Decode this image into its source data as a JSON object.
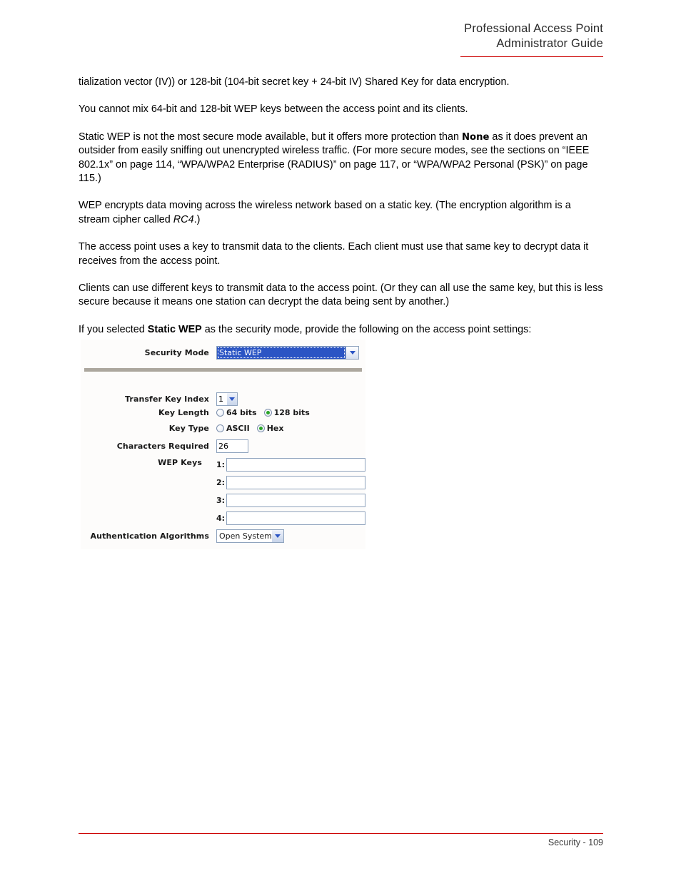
{
  "header": {
    "line1": "Professional Access Point",
    "line2": "Administrator Guide",
    "rule_color": "#cc0000"
  },
  "body": {
    "paragraph_1": "tialization vector (IV)) or 128-bit (104-bit secret key + 24-bit IV) Shared Key for data encryption.",
    "paragraph_2": "You cannot mix 64-bit and 128-bit WEP keys between the access point and its clients.",
    "paragraph_3_a": "Static WEP is not the most secure mode available, but it offers more protection than ",
    "paragraph_3_bold": "None",
    "paragraph_3_b": " as it does prevent an outsider from easily sniffing out unencrypted wireless traffic. (For more secure modes, see the sections on “IEEE 802.1x” on page 114, “WPA/WPA2 Enterprise (RADIUS)” on page 117, or “WPA/WPA2 Personal (PSK)” on page 115.)",
    "paragraph_4_a": "WEP encrypts data moving across the wireless network based on a static key. (The encryption algorithm is a stream cipher called ",
    "paragraph_4_italic": "RC4",
    "paragraph_4_b": ".)",
    "paragraph_5": "The access point uses a key to transmit data to the clients. Each client must use that same key to decrypt data it receives from the access point.",
    "paragraph_6": "Clients can use different keys to transmit data to the access point. (Or they can all use the same key, but this is less secure because it means one station can decrypt the data being sent by another.)",
    "paragraph_7_a": "If you selected ",
    "paragraph_7_bold": "Static WEP",
    "paragraph_7_b": " as the security mode, provide the following on the access point settings:"
  },
  "ui_screenshot": {
    "security_mode": {
      "label": "Security Mode",
      "value": "Static WEP",
      "arrow_icon": "chevron-down-icon",
      "highlight_color": "#2b55c4"
    },
    "divider_color": "#aca79e",
    "transfer_key_index": {
      "label": "Transfer Key Index",
      "value": "1",
      "arrow_icon": "chevron-down-icon"
    },
    "key_length": {
      "label": "Key Length",
      "options": [
        {
          "label": "64 bits",
          "checked": false
        },
        {
          "label": "128 bits",
          "checked": true
        }
      ]
    },
    "key_type": {
      "label": "Key Type",
      "options": [
        {
          "label": "ASCII",
          "checked": false
        },
        {
          "label": "Hex",
          "checked": true
        }
      ]
    },
    "characters_required": {
      "label": "Characters Required",
      "value": "26"
    },
    "wep_keys": {
      "label": "WEP Keys",
      "rows": [
        {
          "index": "1:",
          "value": ""
        },
        {
          "index": "2:",
          "value": ""
        },
        {
          "index": "3:",
          "value": ""
        },
        {
          "index": "4:",
          "value": ""
        }
      ]
    },
    "authentication_algorithms": {
      "label": "Authentication Algorithms",
      "value": "Open System",
      "arrow_icon": "chevron-down-icon"
    },
    "radio_checked_color": "#2aa428"
  },
  "footer": {
    "text": "Security - 109",
    "rule_color": "#cc0000"
  }
}
